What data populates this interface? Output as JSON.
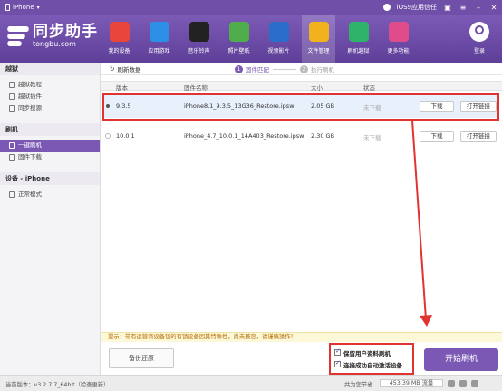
{
  "titlebar": {
    "device": "iPhone",
    "ios_label": "iOS9应用信任"
  },
  "brand": {
    "name": "同步助手",
    "url": "tongbu.com"
  },
  "nav": [
    {
      "label": "我的设备",
      "icon": "device-icon",
      "color": "#e8453c"
    },
    {
      "label": "应用游戏",
      "icon": "appstore-icon",
      "color": "#2c8fe5"
    },
    {
      "label": "音乐铃声",
      "icon": "music-icon",
      "color": "#222222"
    },
    {
      "label": "照片壁纸",
      "icon": "photo-icon",
      "color": "#4fae4b"
    },
    {
      "label": "视频影片",
      "icon": "video-icon",
      "color": "#2b6ec9"
    },
    {
      "label": "文件管理",
      "icon": "folder-icon",
      "color": "#f2b21d"
    },
    {
      "label": "刷机越狱",
      "icon": "flash-icon",
      "color": "#2fb36b"
    },
    {
      "label": "更多功能",
      "icon": "more-icon",
      "color": "#e04b8c"
    }
  ],
  "login_label": "登录",
  "sidebar": {
    "sections": [
      {
        "title": "越狱",
        "items": [
          "越狱教程",
          "越狱插件",
          "同步搜源"
        ]
      },
      {
        "title": "刷机",
        "items": [
          "一键刷机",
          "固件下载"
        ]
      },
      {
        "title": "设备 - iPhone",
        "items": [
          "正常模式"
        ]
      }
    ]
  },
  "toolbar": {
    "refresh_label": "刷新数据"
  },
  "steps": [
    {
      "num": "1",
      "label": "固件匹配"
    },
    {
      "num": "2",
      "label": "执行刷机"
    }
  ],
  "table": {
    "headers": [
      "版本",
      "固件名称",
      "大小",
      "状态"
    ],
    "rows": [
      {
        "version": "9.3.5",
        "firmware": "iPhone8,1_9.3.5_13G36_Restore.ipsw",
        "size": "2.05 GB",
        "status": "未下载",
        "download": "下载",
        "open": "打开链接"
      },
      {
        "version": "10.0.1",
        "firmware": "iPhone_4.7_10.0.1_14A403_Restore.ipsw",
        "size": "2.30 GB",
        "status": "未下载",
        "download": "下载",
        "open": "打开链接"
      }
    ]
  },
  "warning": "提示：带有运营商设备锁的有锁设备因其特殊性，尚未兼容，请谨慎操作！",
  "backup_label": "备份还原",
  "options": [
    "保留用户资料刷机",
    "连接成功自动激活设备"
  ],
  "start_label": "开始刷机",
  "statusbar": {
    "version": "当前版本：v3.2.7.7_64bit（检查更新）",
    "storage": "共为您节省",
    "used": "453.39 MB 流量"
  },
  "accent_color": "#7a58b4",
  "highlight_color": "#e23333"
}
